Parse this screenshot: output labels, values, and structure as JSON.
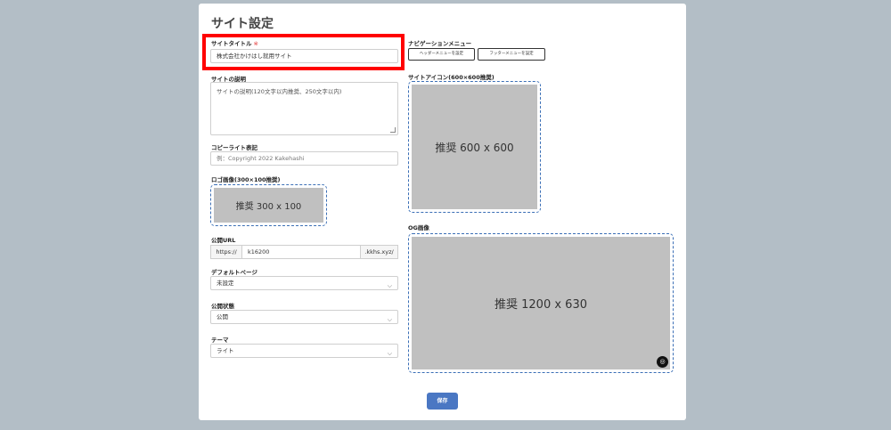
{
  "page": {
    "title": "サイト設定",
    "save_label": "保存"
  },
  "site_title": {
    "label": "サイトタイトル",
    "required_mark": "※",
    "value": "株式会社かけはし就用サイト"
  },
  "site_description": {
    "label": "サイトの説明",
    "placeholder": "サイトの説明(120文字以内推奨、250文字以内)"
  },
  "copyright": {
    "label": "コピーライト表記",
    "placeholder": "例：Copyright 2022 Kakehashi"
  },
  "logo_image": {
    "label": "ロゴ画像(300×100推奨)",
    "placeholder": "推奨 300 x 100"
  },
  "public_url": {
    "label": "公開URL",
    "prefix": "https://",
    "value": "k16200",
    "suffix": ".kkhs.xyz/"
  },
  "default_page": {
    "label": "デフォルトページ",
    "value": "未設定"
  },
  "publish_status": {
    "label": "公開状態",
    "value": "公開"
  },
  "theme": {
    "label": "テーマ",
    "value": "ライト"
  },
  "navigation_menu": {
    "label": "ナビゲーションメニュー",
    "header_button": "ヘッダーメニューを設定",
    "footer_button": "フッターメニューを設定"
  },
  "site_icon": {
    "label": "サイトアイコン(600×600推奨)",
    "placeholder": "推奨 600 x 600"
  },
  "og_image": {
    "label": "OG画像",
    "placeholder": "推奨 1200 x 630",
    "camera_icon": "camera-icon"
  }
}
